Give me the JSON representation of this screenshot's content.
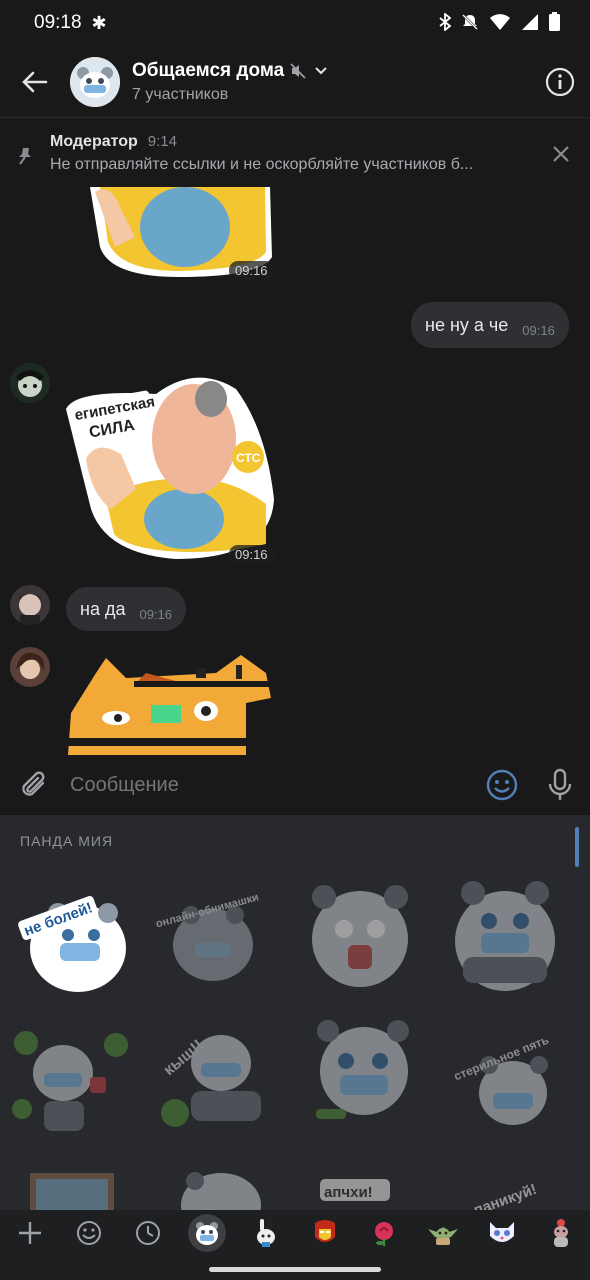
{
  "status_bar": {
    "time": "09:18"
  },
  "header": {
    "title": "Общаемся дома",
    "subtitle": "7 участников"
  },
  "pinned": {
    "author": "Модератор",
    "time": "9:14",
    "text": "Не отправляйте ссылки и не оскорбляйте участников б..."
  },
  "messages": [
    {
      "type": "sticker",
      "time": "09:16",
      "side": "left"
    },
    {
      "type": "text",
      "text": "не ну а че",
      "time": "09:16",
      "side": "right"
    },
    {
      "type": "sticker",
      "time": "09:16",
      "side": "left",
      "caption_1": "египетская",
      "caption_2": "СИЛА",
      "badge": "СТС"
    },
    {
      "type": "text",
      "text": "на да",
      "time": "09:16",
      "side": "left"
    },
    {
      "type": "sticker",
      "side": "left"
    }
  ],
  "input": {
    "placeholder": "Сообщение"
  },
  "sticker_panel": {
    "pack_name": "ПАНДА МИЯ",
    "stickers": [
      {
        "caption": "не болей!"
      },
      {
        "caption": "онлайн-обнимашки"
      },
      {
        "caption": ""
      },
      {
        "caption": ""
      },
      {
        "caption": ""
      },
      {
        "caption": "кыш!!"
      },
      {
        "caption": ""
      },
      {
        "caption": "стерильное пять"
      },
      {
        "caption": ""
      },
      {
        "caption": ""
      },
      {
        "caption": "апчхи!"
      },
      {
        "caption": "не паникуй!"
      }
    ]
  },
  "tabs": [
    "add",
    "emoji",
    "recent",
    "panda-pack",
    "rabbit-pack",
    "ironman-pack",
    "rose-pack",
    "yoda-pack",
    "cat-pack",
    "monkey-pack"
  ],
  "colors": {
    "accent": "#5181b8",
    "background": "#19191a",
    "bubble": "#2f3033"
  }
}
